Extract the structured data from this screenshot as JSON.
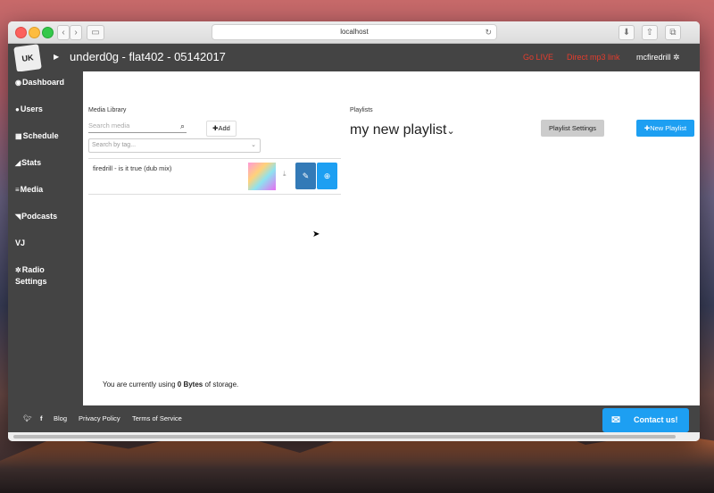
{
  "browser": {
    "address": "localhost"
  },
  "app": {
    "logo_text": "UK",
    "station_title": "underd0g - flat402 - 05142017",
    "go_live": "Go LIVE",
    "direct_mp3": "Direct mp3 link",
    "user": "mcfiredrill"
  },
  "sidebar": {
    "items": [
      {
        "label": "Dashboard",
        "icon": "dashboard-icon",
        "glyph": "◉"
      },
      {
        "label": "Users",
        "icon": "user-icon",
        "glyph": "●"
      },
      {
        "label": "Schedule",
        "icon": "calendar-icon",
        "glyph": "▦"
      },
      {
        "label": "Stats",
        "icon": "chart-icon",
        "glyph": "◢"
      },
      {
        "label": "Media",
        "icon": "list-icon",
        "glyph": "≡"
      },
      {
        "label": "Podcasts",
        "icon": "rss-icon",
        "glyph": "◥"
      },
      {
        "label": "VJ",
        "icon": "",
        "glyph": ""
      },
      {
        "label": "Radio Settings",
        "icon": "gear-icon",
        "glyph": "✲"
      }
    ]
  },
  "media_library": {
    "heading": "Media Library",
    "search_placeholder": "Search media",
    "add_label": "Add",
    "tag_placeholder": "Search by tag...",
    "items": [
      {
        "title": "firedrill - is it true (dub mix)"
      }
    ],
    "storage_prefix": "You are currently using ",
    "storage_amount": "0 Bytes",
    "storage_suffix": " of storage."
  },
  "playlists": {
    "heading": "Playlists",
    "current": "my new playlist",
    "settings_label": "Playlist Settings",
    "new_label": "New Playlist"
  },
  "footer": {
    "links": [
      "Blog",
      "Privacy Policy",
      "Terms of Service"
    ],
    "contact": "Contact us!"
  },
  "colors": {
    "primary": "#1d9ff2",
    "edit": "#337ab7",
    "dark": "#444444",
    "live_red": "#e53c2d"
  }
}
